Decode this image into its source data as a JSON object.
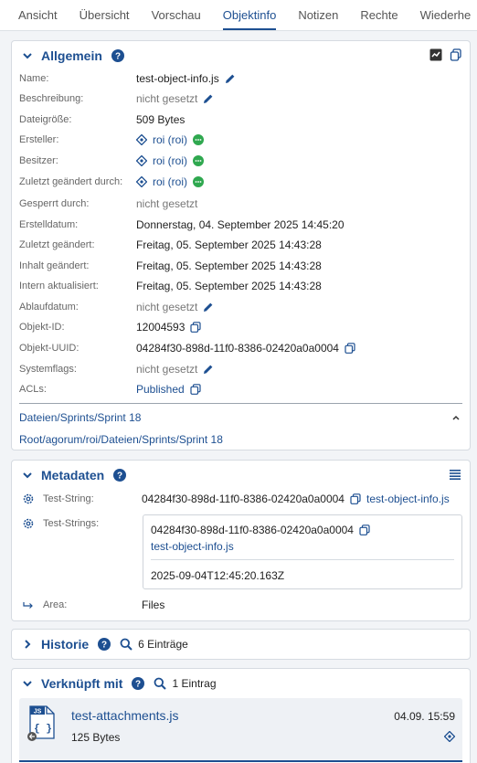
{
  "tabs": [
    "Ansicht",
    "Übersicht",
    "Vorschau",
    "Objektinfo",
    "Notizen",
    "Rechte",
    "Wiederhe"
  ],
  "general": {
    "title": "Allgemein",
    "rows": [
      {
        "label": "Name:",
        "value": "test-object-info.js"
      },
      {
        "label": "Beschreibung:",
        "value": "nicht gesetzt"
      },
      {
        "label": "Dateigröße:",
        "value": "509 Bytes"
      },
      {
        "label": "Ersteller:",
        "value": "roi (roi)"
      },
      {
        "label": "Besitzer:",
        "value": "roi (roi)"
      },
      {
        "label": "Zuletzt geändert durch:",
        "value": "roi (roi)"
      },
      {
        "label": "Gesperrt durch:",
        "value": "nicht gesetzt"
      },
      {
        "label": "Erstelldatum:",
        "value": "Donnerstag, 04. September 2025 14:45:20"
      },
      {
        "label": "Zuletzt geändert:",
        "value": "Freitag, 05. September 2025 14:43:28"
      },
      {
        "label": "Inhalt geändert:",
        "value": "Freitag, 05. September 2025 14:43:28"
      },
      {
        "label": "Intern aktualisiert:",
        "value": "Freitag, 05. September 2025 14:43:28"
      },
      {
        "label": "Ablaufdatum:",
        "value": "nicht gesetzt"
      },
      {
        "label": "Objekt-ID:",
        "value": "12004593"
      },
      {
        "label": "Objekt-UUID:",
        "value": "04284f30-898d-11f0-8386-02420a0a0004"
      },
      {
        "label": "Systemflags:",
        "value": "nicht gesetzt"
      },
      {
        "label": "ACLs:",
        "value": "Published"
      }
    ],
    "path1": [
      "Dateien",
      "Sprints",
      "Sprint 18"
    ],
    "path2": [
      "Root",
      "agorum",
      "roi",
      "Dateien",
      "Sprints",
      "Sprint 18"
    ]
  },
  "metadata": {
    "title": "Metadaten",
    "test_string_label": "Test-String:",
    "test_string_value": "04284f30-898d-11f0-8386-02420a0a0004",
    "test_string_link": "test-object-info.js",
    "test_strings_label": "Test-Strings:",
    "test_strings_value": "04284f30-898d-11f0-8386-02420a0a0004",
    "test_strings_link": "test-object-info.js",
    "test_strings_date": "2025-09-04T12:45:20.163Z",
    "area_label": "Area:",
    "area_value": "Files"
  },
  "history": {
    "title": "Historie",
    "count": "6 Einträge"
  },
  "linked": {
    "title": "Verknüpft mit",
    "count": "1 Eintrag",
    "item_name": "test-attachments.js",
    "item_date": "04.09. 15:59",
    "item_size": "125 Bytes",
    "file_badge": "JS"
  },
  "colors": {
    "accent": "#1d4f91",
    "chat": "#2fa84f",
    "border": "#d6dbe1"
  }
}
